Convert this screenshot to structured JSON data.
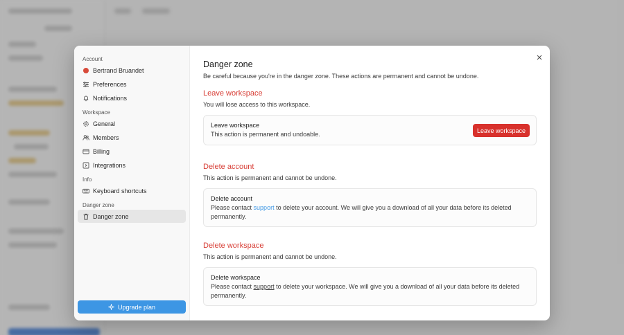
{
  "nav": {
    "sections": [
      {
        "label": "Account",
        "items": [
          {
            "label": "Bertrand Bruandet",
            "icon": "avatar"
          },
          {
            "label": "Preferences",
            "icon": "sliders-icon"
          },
          {
            "label": "Notifications",
            "icon": "bell-icon"
          }
        ]
      },
      {
        "label": "Workspace",
        "items": [
          {
            "label": "General",
            "icon": "gear-icon"
          },
          {
            "label": "Members",
            "icon": "users-icon"
          },
          {
            "label": "Billing",
            "icon": "credit-card-icon"
          },
          {
            "label": "Integrations",
            "icon": "integrations-icon"
          }
        ]
      },
      {
        "label": "Info",
        "items": [
          {
            "label": "Keyboard shortcuts",
            "icon": "keyboard-icon"
          }
        ]
      },
      {
        "label": "Danger zone",
        "items": [
          {
            "label": "Danger zone",
            "icon": "trash-icon",
            "active": true
          }
        ]
      }
    ],
    "upgrade_label": "Upgrade plan"
  },
  "content": {
    "title": "Danger zone",
    "intro": "Be careful because you're in the danger zone. These actions are permanent and cannot be undone.",
    "leave": {
      "title": "Leave workspace",
      "desc": "You will lose access to this workspace.",
      "card_title": "Leave workspace",
      "card_text": "This action is permanent and undoable.",
      "button": "Leave workspace"
    },
    "delete_account": {
      "title": "Delete account",
      "desc": "This action is permanent and cannot be undone.",
      "card_title": "Delete account",
      "text_before": "Please contact ",
      "link": "support",
      "text_after": " to delete your account. We will give you a download of all your data before its deleted permanently."
    },
    "delete_workspace": {
      "title": "Delete workspace",
      "desc": "This action is permanent and cannot be undone.",
      "card_title": "Delete workspace",
      "text_before": "Please contact ",
      "link": "support",
      "text_after": " to delete your workspace. We will give you a download of all your data before its deleted permanently."
    }
  },
  "colors": {
    "accent": "#3d96e4",
    "danger": "#d8312c",
    "danger_text": "#d84038"
  }
}
